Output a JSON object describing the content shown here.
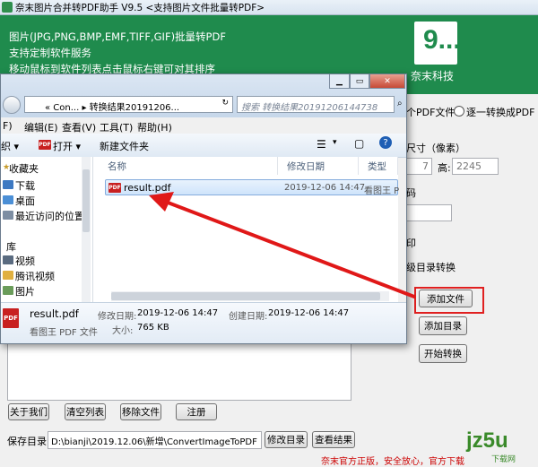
{
  "app": {
    "title": "奈末图片合并转PDF助手 V9.5  <支持图片文件批量转PDF>",
    "header_lines": [
      "图片(JPG,PNG,BMP,EMF,TIFF,GIF)批量转PDF",
      "支持定制软件服务",
      "移动鼠标到软件列表点击鼠标右键可对其排序"
    ],
    "logo_mark": "9...",
    "brand": "奈末科技",
    "green": "#1f8b4d"
  },
  "side": {
    "merge_option": "个PDF文件",
    "each_option": "逐一转换成PDF",
    "size_label": "尺寸（像素）",
    "width_value": "7",
    "height_label": "高:",
    "height_value": "2245",
    "code_label": "码",
    "print_label": "印",
    "subdir_label": "级目录转换",
    "add_file": "添加文件",
    "add_dir": "添加目录",
    "start": "开始转换"
  },
  "bottom": {
    "about": "关于我们",
    "clear": "清空列表",
    "remove": "移除文件",
    "register": "注册",
    "save_label": "保存目录:",
    "save_path": "D:\\bianji\\2019.12.06\\新增\\ConvertImageToPDF",
    "change_dir": "修改目录",
    "view_result": "查看结果",
    "footer": "奈末官方正版，安全放心，官方下载",
    "watermark": "jz5u",
    "watermark_sub": "下载网"
  },
  "dialog": {
    "address": "« Con... ▸ 转换结果20191206...",
    "search_placeholder": "搜索 转换结果20191206144738",
    "menu": [
      "编辑(E)",
      "查看(V)",
      "工具(T)",
      "帮助(H)"
    ],
    "menu_first": "F)",
    "toolbar_org": "织 ▾",
    "toolbar_open": "打开 ▾",
    "toolbar_newfolder": "新建文件夹",
    "nav": [
      "收藏夹",
      "下载",
      "桌面",
      "最近访问的位置",
      "库",
      "视频",
      "腾讯视频",
      "图片"
    ],
    "columns": [
      "名称",
      "修改日期",
      "类型"
    ],
    "files": [
      {
        "name": "result.pdf",
        "date": "2019-12-06 14:47",
        "type": "看图王 P"
      }
    ],
    "details": {
      "name": "result.pdf",
      "kind": "看图王 PDF 文件",
      "modified_label": "修改日期:",
      "modified": "2019-12-06 14:47",
      "created_label": "创建日期:",
      "created": "2019-12-06 14:47",
      "size_label": "大小:",
      "size": "765 KB"
    }
  }
}
